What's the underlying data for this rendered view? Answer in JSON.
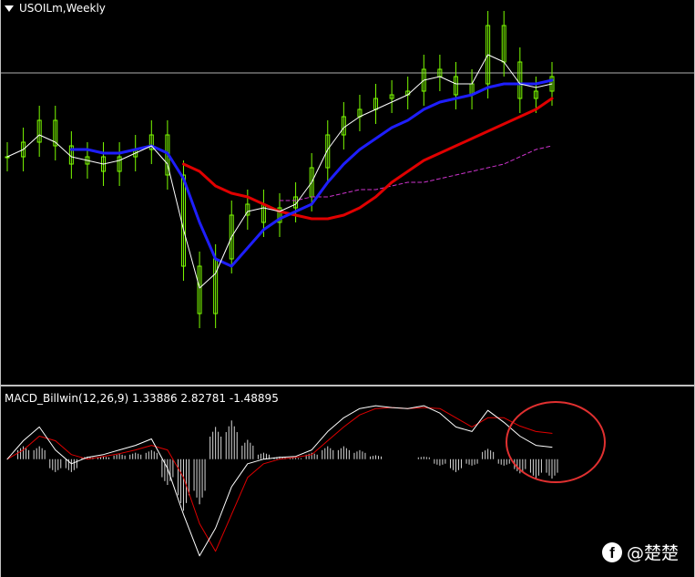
{
  "chart_title": "USOILm,Weekly",
  "macd": {
    "name": "MACD_Billwin",
    "params": "(12,26,9)",
    "main_value": "1.33886",
    "signal_value": "2.82781",
    "histogram_value": "-1.48895"
  },
  "watermark": "@楚楚",
  "watermark_icon": "facebook-icon",
  "colors": {
    "background": "#000000",
    "candle": "#7CFC00",
    "ma_fast": "#FFFFFF",
    "ma_mid_red": "#FF2020",
    "ma_blue": "#1E1EFF",
    "ma_red_thick": "#E00000",
    "ma_magenta": "#CC33CC",
    "macd_main": "#FFFFFF",
    "macd_signal": "#E00000",
    "annotation_circle": "#E03030"
  },
  "chart_data": {
    "type": "line",
    "price_ylim": [
      0,
      100
    ],
    "macd_ylim": [
      -12,
      7
    ],
    "horizontal_level": 83,
    "x": [
      0,
      3,
      6,
      9,
      12,
      15,
      18,
      21,
      24,
      27,
      30,
      33,
      36,
      39,
      42,
      45,
      48,
      51,
      54,
      57,
      60,
      63,
      66,
      69,
      72,
      75,
      78,
      81,
      84,
      87,
      90,
      93,
      96,
      99,
      102
    ],
    "series": [
      {
        "key": "price",
        "values": [
          60,
          64,
          70,
          63,
          58,
          60,
          56,
          60,
          62,
          66,
          55,
          30,
          17,
          32,
          44,
          47,
          42,
          46,
          49,
          57,
          66,
          71,
          73,
          76,
          77,
          78,
          84,
          82,
          77,
          80,
          96,
          86,
          76,
          78,
          82
        ]
      },
      {
        "key": "ma_fast",
        "values": [
          60,
          62,
          66,
          64,
          60,
          59,
          58,
          59,
          61,
          63,
          58,
          40,
          24,
          28,
          38,
          45,
          46,
          45,
          47,
          53,
          62,
          68,
          71,
          73,
          75,
          77,
          81,
          82,
          80,
          80,
          88,
          86,
          80,
          79,
          80
        ]
      },
      {
        "key": "ma_blue",
        "values": [
          null,
          null,
          null,
          null,
          62,
          62,
          61,
          61,
          62,
          63,
          61,
          54,
          42,
          32,
          30,
          35,
          40,
          43,
          45,
          47,
          53,
          58,
          62,
          65,
          68,
          70,
          73,
          75,
          76,
          77,
          79,
          80,
          80,
          80,
          81
        ]
      },
      {
        "key": "ma_red",
        "values": [
          null,
          null,
          null,
          null,
          null,
          null,
          null,
          null,
          null,
          null,
          null,
          58,
          56,
          52,
          50,
          49,
          47,
          45,
          44,
          43,
          43,
          44,
          46,
          49,
          53,
          56,
          59,
          61,
          63,
          65,
          67,
          69,
          71,
          73,
          76
        ]
      },
      {
        "key": "ma_magenta",
        "values": [
          null,
          null,
          null,
          null,
          null,
          null,
          null,
          null,
          null,
          null,
          null,
          null,
          null,
          null,
          null,
          null,
          null,
          48,
          48,
          49,
          49,
          50,
          51,
          51,
          52,
          53,
          53,
          54,
          55,
          56,
          57,
          58,
          60,
          62,
          63
        ]
      },
      {
        "key": "macd_main",
        "values": [
          0,
          2,
          3.5,
          1,
          -0.5,
          0.2,
          0.5,
          1,
          1.5,
          2.2,
          -1,
          -6,
          -10.5,
          -7.5,
          -3,
          -0.5,
          0,
          0.2,
          0.3,
          1,
          3,
          4.5,
          5.5,
          5.8,
          5.6,
          5.5,
          5.8,
          5,
          3.5,
          3,
          5.3,
          4,
          2.5,
          1.5,
          1.3
        ]
      },
      {
        "key": "macd_signal",
        "values": [
          0,
          1,
          2.5,
          2,
          0.5,
          0,
          0.3,
          0.6,
          1,
          1.5,
          1,
          -2,
          -7,
          -10,
          -6,
          -2,
          -0.5,
          0,
          0.2,
          0.5,
          2,
          3.5,
          4.8,
          5.5,
          5.6,
          5.5,
          5.6,
          5.5,
          4.5,
          3.5,
          4.5,
          4.5,
          3.6,
          3,
          2.8
        ]
      }
    ]
  }
}
